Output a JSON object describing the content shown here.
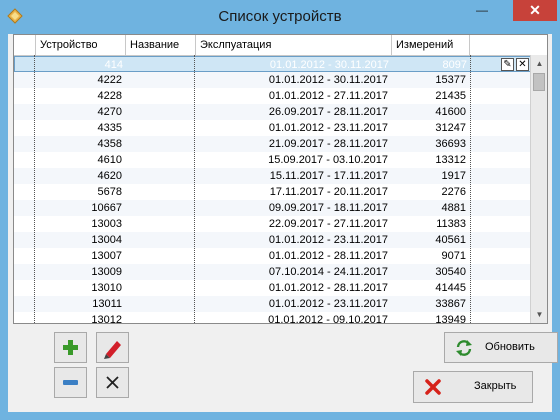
{
  "window": {
    "title": "Список устройств",
    "controls": {
      "minimize": "—",
      "maximize": "□",
      "close": "✕"
    }
  },
  "grid": {
    "columns": [
      "Устройство",
      "Название",
      "Экслпуатация",
      "Измерений"
    ],
    "selected_index": 0,
    "rows": [
      {
        "device": "414",
        "name": "",
        "period": "01.01.2012 - 30.11.2017",
        "count": "8097"
      },
      {
        "device": "4222",
        "name": "",
        "period": "01.01.2012 - 30.11.2017",
        "count": "15377"
      },
      {
        "device": "4228",
        "name": "",
        "period": "01.01.2012 - 27.11.2017",
        "count": "21435"
      },
      {
        "device": "4270",
        "name": "",
        "period": "26.09.2017 - 28.11.2017",
        "count": "41600"
      },
      {
        "device": "4335",
        "name": "",
        "period": "01.01.2012 - 23.11.2017",
        "count": "31247"
      },
      {
        "device": "4358",
        "name": "",
        "period": "21.09.2017 - 28.11.2017",
        "count": "36693"
      },
      {
        "device": "4610",
        "name": "",
        "period": "15.09.2017 - 03.10.2017",
        "count": "13312"
      },
      {
        "device": "4620",
        "name": "",
        "period": "15.11.2017 - 17.11.2017",
        "count": "1917"
      },
      {
        "device": "5678",
        "name": "",
        "period": "17.11.2017 - 20.11.2017",
        "count": "2276"
      },
      {
        "device": "10667",
        "name": "",
        "period": "09.09.2017 - 18.11.2017",
        "count": "4881"
      },
      {
        "device": "13003",
        "name": "",
        "period": "22.09.2017 - 27.11.2017",
        "count": "11383"
      },
      {
        "device": "13004",
        "name": "",
        "period": "01.01.2012 - 23.11.2017",
        "count": "40561"
      },
      {
        "device": "13007",
        "name": "",
        "period": "01.01.2012 - 28.11.2017",
        "count": "9071"
      },
      {
        "device": "13009",
        "name": "",
        "period": "07.10.2014 - 24.11.2017",
        "count": "30540"
      },
      {
        "device": "13010",
        "name": "",
        "period": "01.01.2012 - 28.11.2017",
        "count": "41445"
      },
      {
        "device": "13011",
        "name": "",
        "period": "01.01.2012 - 23.11.2017",
        "count": "33867"
      },
      {
        "device": "13012",
        "name": "",
        "period": "01.01.2012 - 09.10.2017",
        "count": "13949"
      }
    ]
  },
  "buttons": {
    "refresh_label": "Обновить",
    "close_label": "Закрыть"
  },
  "icons": {
    "app": "diamond-icon",
    "add": "plus-icon",
    "edit": "pencil-icon",
    "remove": "minus-icon",
    "delete": "cross-icon",
    "refresh": "refresh-icon",
    "close": "close-x-icon"
  },
  "colors": {
    "titlebar": "#6fb3e0",
    "close_button": "#c7423a",
    "selection": "#cfe6f5",
    "add_green": "#3a9a2a",
    "remove_blue": "#3b7fc4",
    "close_red": "#d6221a"
  }
}
